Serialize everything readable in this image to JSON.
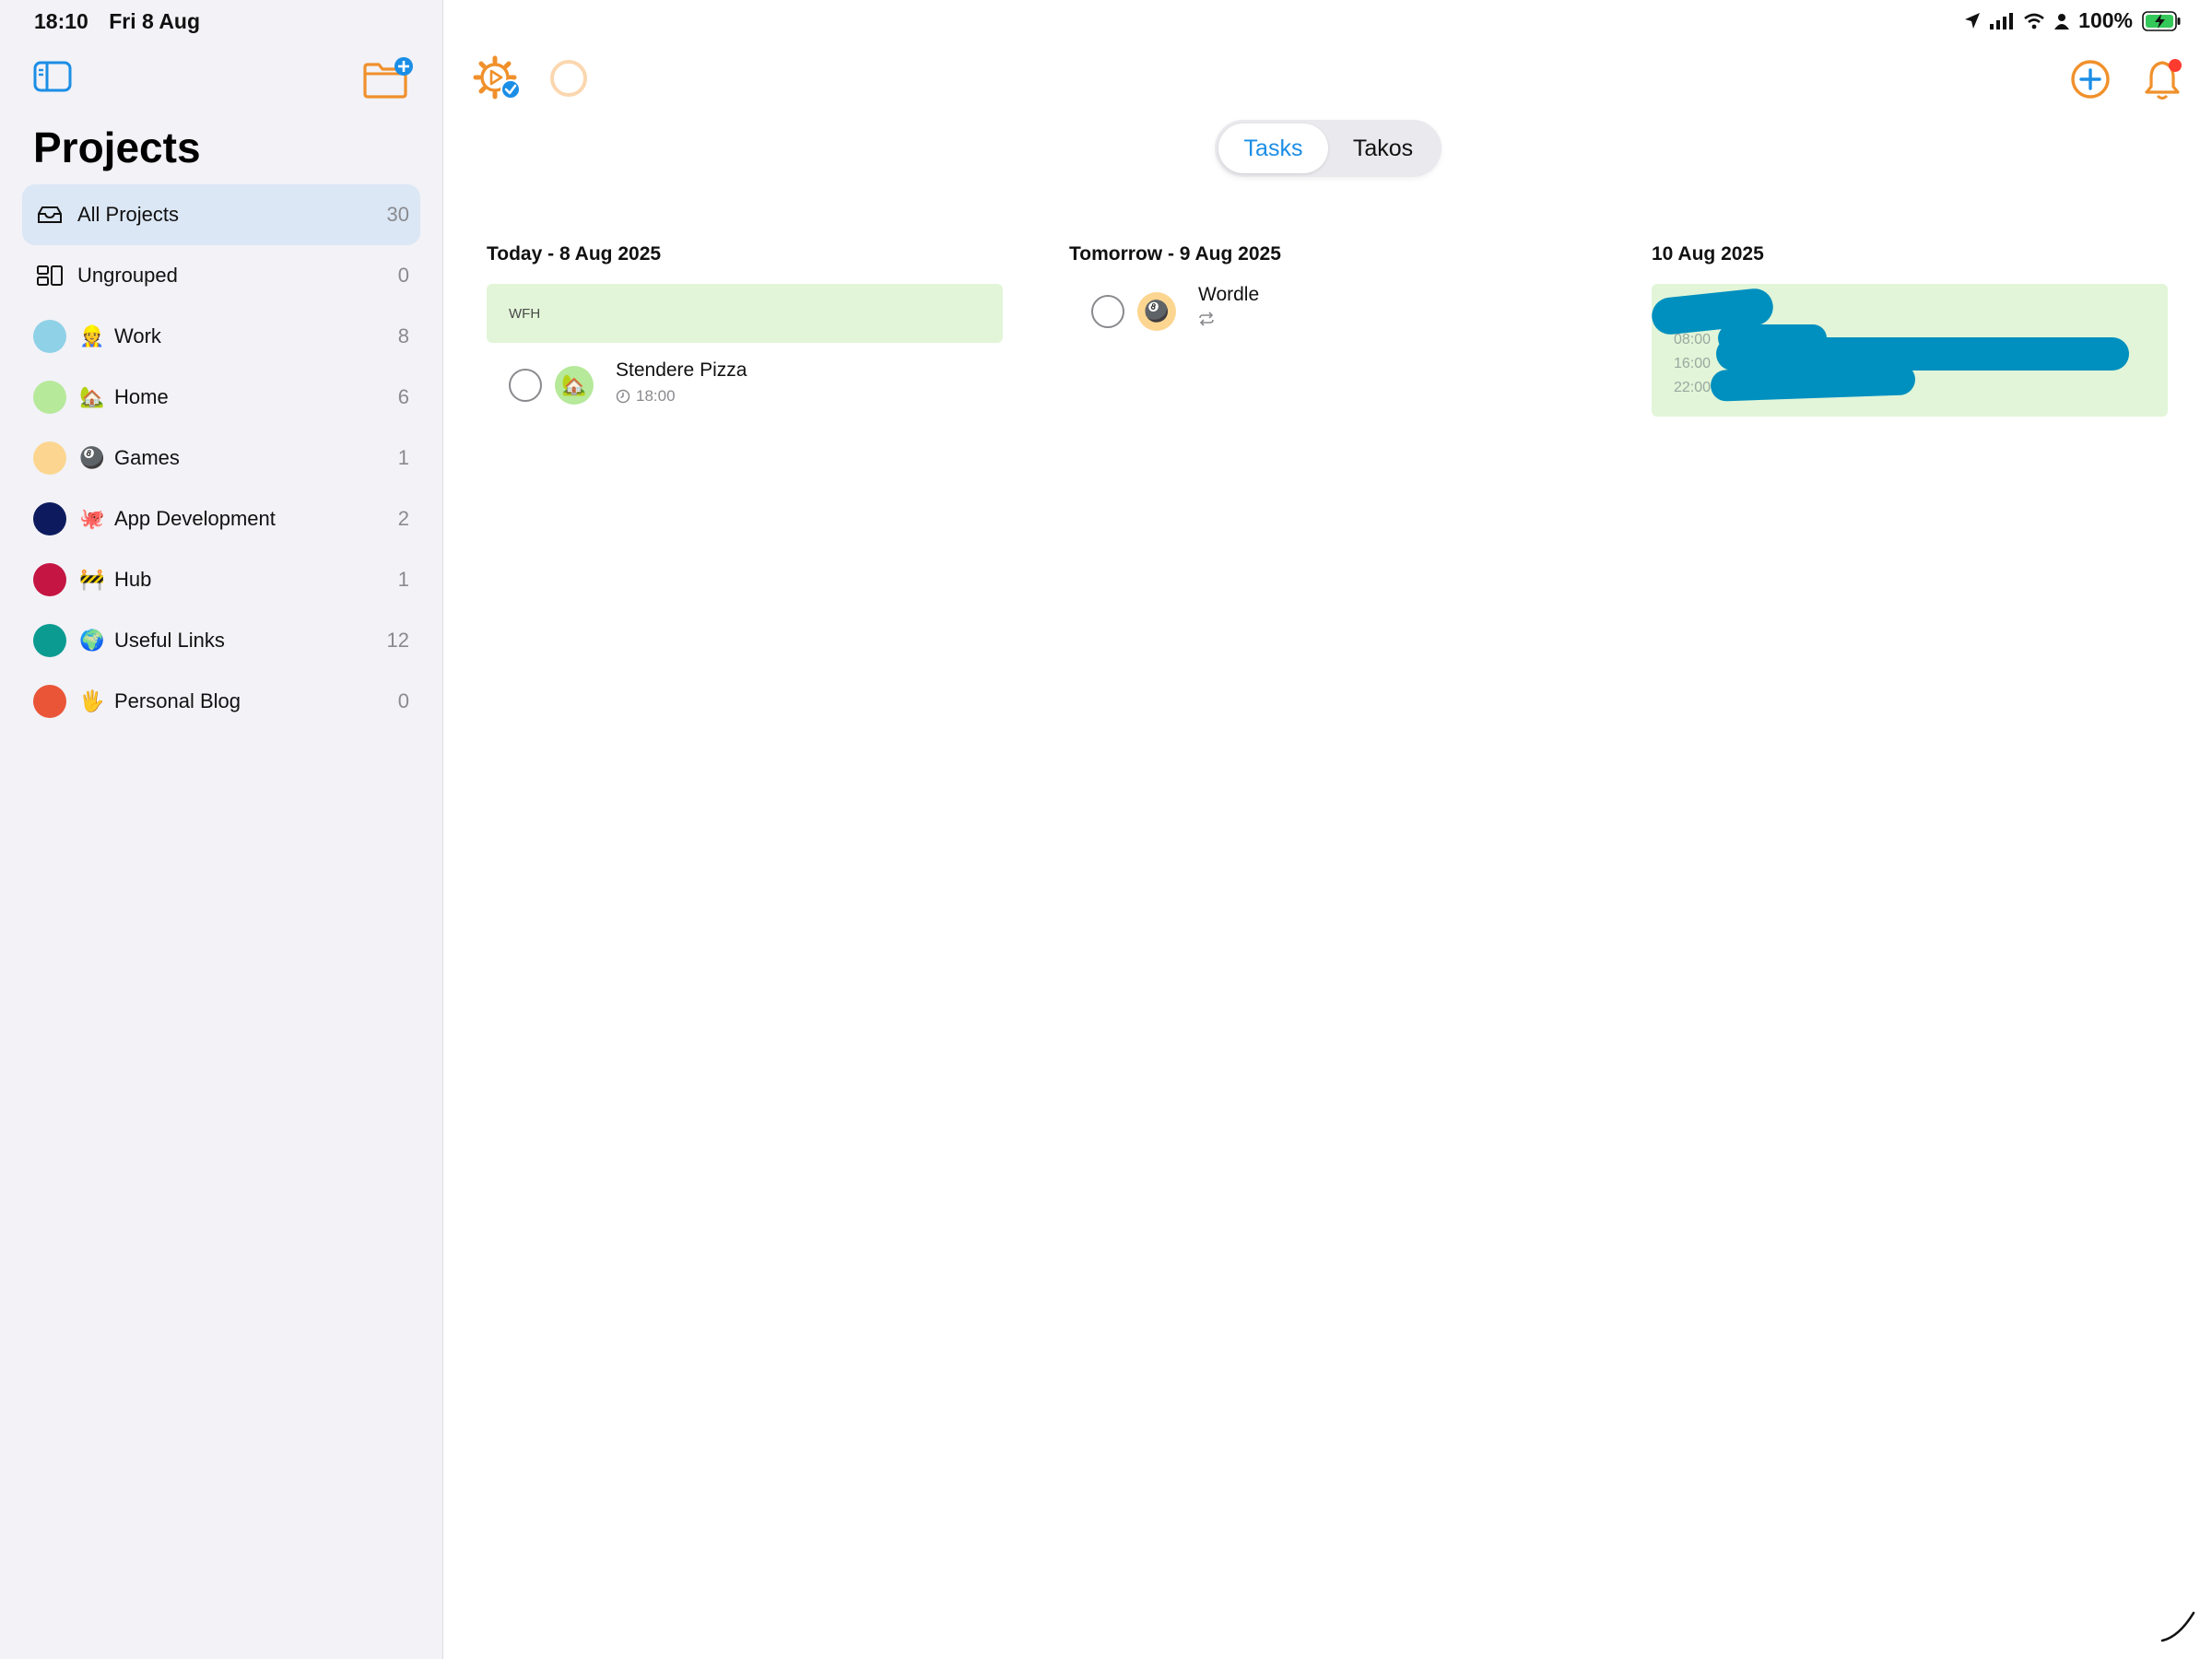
{
  "status_bar": {
    "time": "18:10",
    "date": "Fri 8 Aug",
    "battery": "100%"
  },
  "sidebar": {
    "title": "Projects",
    "items": [
      {
        "name": "All Projects",
        "count": "30",
        "emoji": "",
        "color": ""
      },
      {
        "name": "Ungrouped",
        "count": "0",
        "emoji": "",
        "color": ""
      },
      {
        "name": "Work",
        "count": "8",
        "emoji": "👷",
        "color": "#8fd1e6"
      },
      {
        "name": "Home",
        "count": "6",
        "emoji": "🏡",
        "color": "#b6e99a"
      },
      {
        "name": "Games",
        "count": "1",
        "emoji": "🎱",
        "color": "#fcd690"
      },
      {
        "name": "App Development",
        "count": "2",
        "emoji": "🐙",
        "color": "#0d1b5e"
      },
      {
        "name": "Hub",
        "count": "1",
        "emoji": "🚧",
        "color": "#c41543"
      },
      {
        "name": "Useful Links",
        "count": "12",
        "emoji": "🌍",
        "color": "#0b9b91"
      },
      {
        "name": "Personal Blog",
        "count": "0",
        "emoji": "🖐️",
        "color": "#ea5538"
      }
    ]
  },
  "tabs": {
    "tasks": "Tasks",
    "takos": "Takos"
  },
  "columns": [
    {
      "header": "Today - 8 Aug 2025",
      "event": "WFH",
      "task": {
        "title": "Stendere Pizza",
        "time": "18:00",
        "emoji": "🏡"
      }
    },
    {
      "header": "Tomorrow - 9 Aug 2025",
      "task": {
        "title": "Wordle",
        "emoji": "🎱"
      }
    },
    {
      "header": "10 Aug 2025",
      "event_times": [
        "08:00",
        "16:00",
        "22:00"
      ]
    }
  ],
  "colors": {
    "accent_orange": "#f0902b",
    "accent_blue": "#1b8ee6",
    "selected_row": "#dce7f5",
    "event_green": "#e2f5d8",
    "notification_dot": "#ff3b30"
  }
}
